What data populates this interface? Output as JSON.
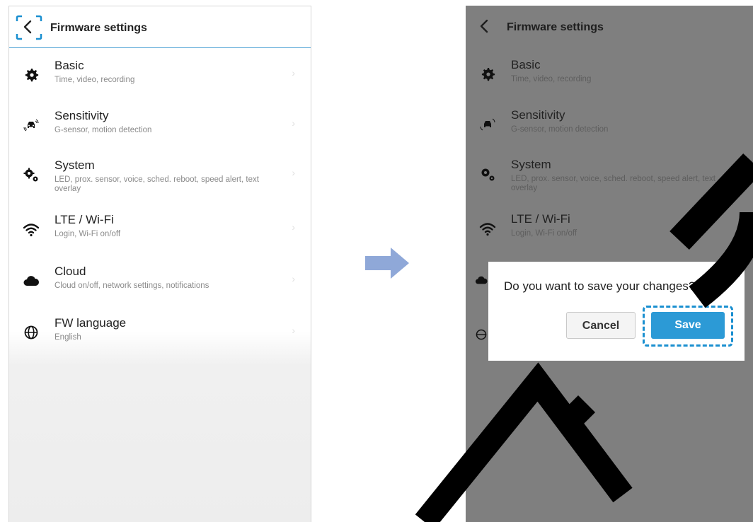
{
  "screen_before": {
    "header": {
      "title": "Firmware settings"
    },
    "items": [
      {
        "title": "Basic",
        "subtitle": "Time, video, recording",
        "icon": "gear-icon"
      },
      {
        "title": "Sensitivity",
        "subtitle": "G-sensor, motion detection",
        "icon": "car-sensor-icon"
      },
      {
        "title": "System",
        "subtitle": "LED, prox. sensor, voice, sched. reboot, speed alert, text overlay",
        "icon": "gears-icon"
      },
      {
        "title": "LTE / Wi-Fi",
        "subtitle": "Login, Wi-Fi on/off",
        "icon": "wifi-icon"
      },
      {
        "title": "Cloud",
        "subtitle": "Cloud on/off, network settings, notifications",
        "icon": "cloud-icon"
      },
      {
        "title": "FW language",
        "subtitle": "English",
        "icon": "globe-icon"
      }
    ]
  },
  "screen_after": {
    "header": {
      "title": "Firmware settings"
    },
    "items": [
      {
        "title": "Basic",
        "subtitle": "Time, video, recording",
        "icon": "gear-icon"
      },
      {
        "title": "Sensitivity",
        "subtitle": "G-sensor, motion detection",
        "icon": "car-sensor-icon"
      },
      {
        "title": "System",
        "subtitle": "LED, prox. sensor, voice, sched. reboot, speed alert, text overlay",
        "icon": "gears-icon"
      },
      {
        "title": "LTE / Wi-Fi",
        "subtitle": "Login, Wi-Fi on/off",
        "icon": "wifi-icon"
      }
    ],
    "dialog": {
      "message": "Do you want to save your changes?",
      "cancel_label": "Cancel",
      "save_label": "Save"
    }
  },
  "colors": {
    "accent": "#2c9ad6",
    "focus_outline": "#1a8fd0",
    "transition_arrow": "#8fa8d8",
    "dim_overlay": "#7f7f7f"
  }
}
